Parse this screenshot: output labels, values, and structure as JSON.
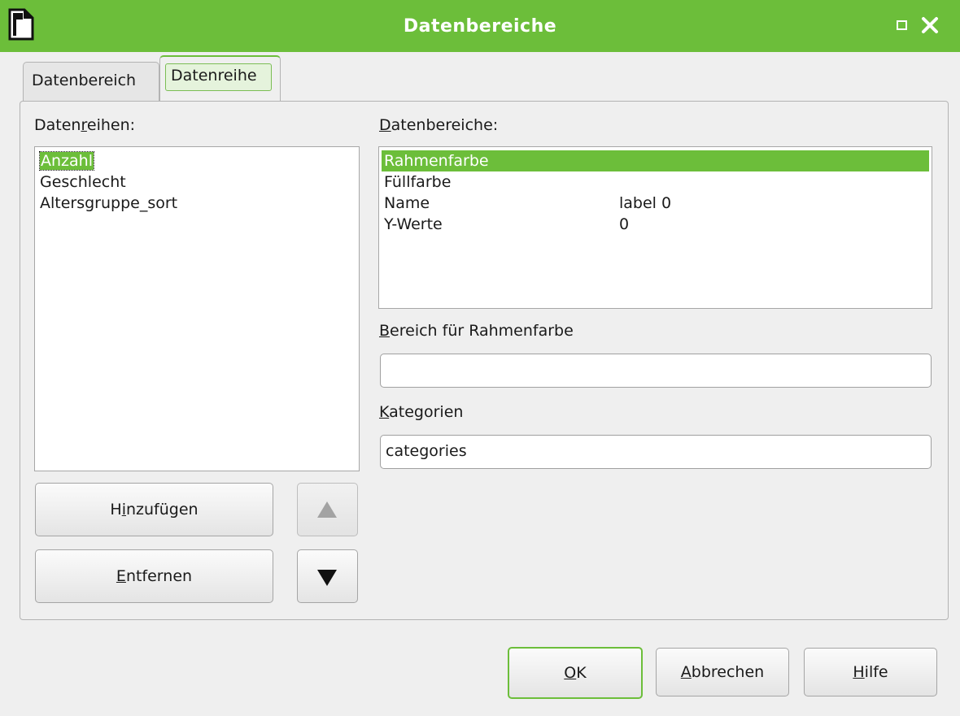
{
  "window": {
    "title": "Datenbereiche",
    "accent_color": "#6cbe3a"
  },
  "tabs": [
    {
      "label": "Datenbereich",
      "active": false
    },
    {
      "label": "Datenreihe",
      "active": true
    }
  ],
  "series_panel": {
    "label_pre": "Daten",
    "label_u": "r",
    "label_post": "eihen:",
    "items": [
      {
        "label": "Anzahl",
        "selected": true
      },
      {
        "label": "Geschlecht",
        "selected": false
      },
      {
        "label": "Altersgruppe_sort",
        "selected": false
      }
    ]
  },
  "ranges_panel": {
    "label_u": "D",
    "label_post": "atenbereiche:",
    "rows": [
      {
        "name": "Rahmenfarbe",
        "value": "",
        "selected": true
      },
      {
        "name": "Füllfarbe",
        "value": "",
        "selected": false
      },
      {
        "name": "Name",
        "value": "label 0",
        "selected": false
      },
      {
        "name": "Y-Werte",
        "value": "0",
        "selected": false
      }
    ]
  },
  "range_field": {
    "label_u": "B",
    "label_post": "ereich für Rahmenfarbe",
    "value": ""
  },
  "categories_field": {
    "label_u": "K",
    "label_post": "ategorien",
    "value": "categories"
  },
  "buttons": {
    "add_pre": "H",
    "add_u": "i",
    "add_post": "nzufügen",
    "remove_u": "E",
    "remove_post": "ntfernen",
    "ok_u": "O",
    "ok_post": "K",
    "cancel_u": "A",
    "cancel_post": "bbrechen",
    "help_u": "H",
    "help_post": "ilfe"
  },
  "icons": {
    "app": "document-icon",
    "maximize": "maximize-icon",
    "close": "close-icon",
    "move_up": "arrow-up-icon",
    "move_down": "arrow-down-icon"
  }
}
